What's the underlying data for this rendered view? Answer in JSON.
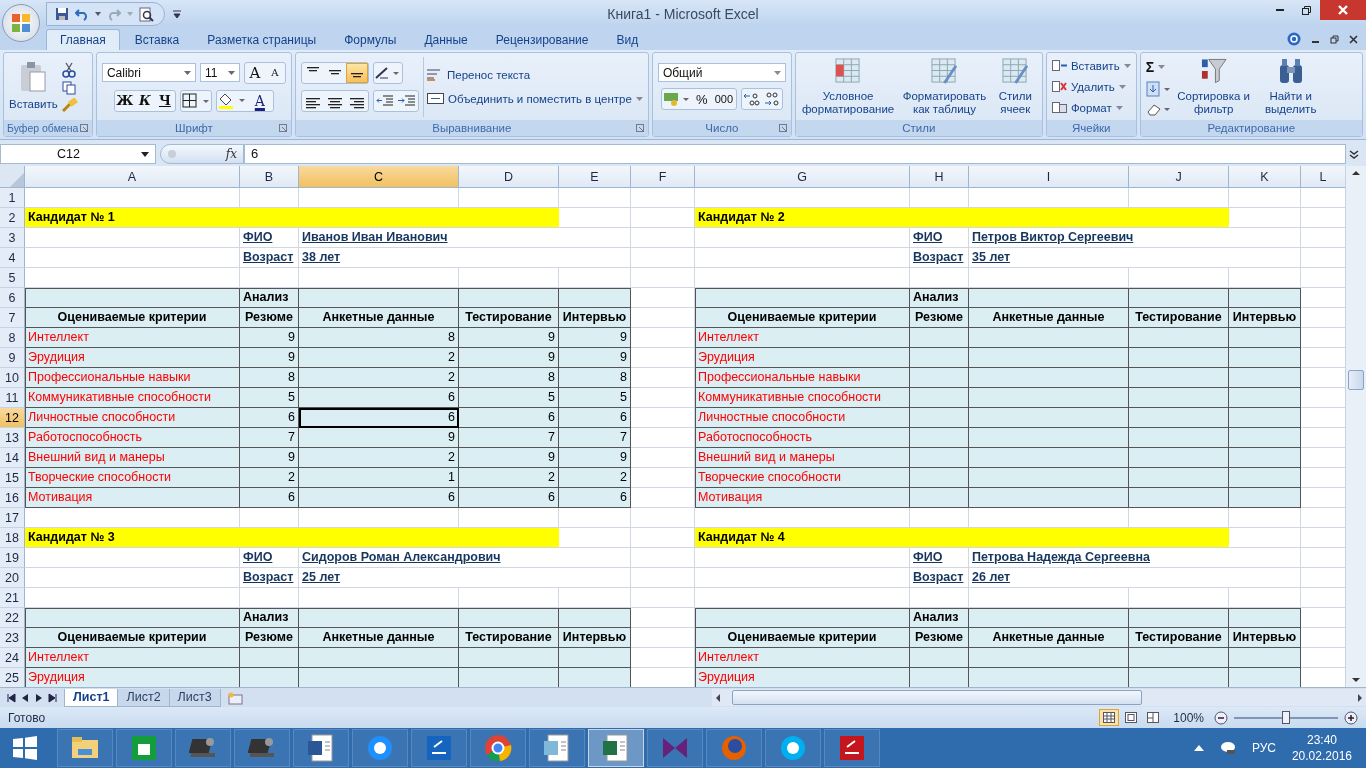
{
  "window": {
    "title": "Книга1 - Microsoft Excel"
  },
  "tabs": [
    {
      "label": "Главная",
      "selected": true
    },
    {
      "label": "Вставка",
      "selected": false
    },
    {
      "label": "Разметка страницы",
      "selected": false
    },
    {
      "label": "Формулы",
      "selected": false
    },
    {
      "label": "Данные",
      "selected": false
    },
    {
      "label": "Рецензирование",
      "selected": false
    },
    {
      "label": "Вид",
      "selected": false
    }
  ],
  "ribbon": {
    "clipboard": {
      "label": "Буфер обмена",
      "paste": "Вставить"
    },
    "font": {
      "label": "Шрифт",
      "font": "Calibri",
      "size": "11",
      "grow": "A",
      "shrink": "A",
      "bold": "Ж",
      "italic": "К",
      "underline": "Ч",
      "font_color": "A"
    },
    "alignment": {
      "label": "Выравнивание",
      "vertical": [
        {
          "selected": false
        },
        {
          "selected": false
        },
        {
          "selected": true
        }
      ],
      "wrap": "Перенос текста",
      "merge": "Объединить и поместить в центре"
    },
    "number": {
      "label": "Число",
      "format": "Общий",
      "percent": "%",
      "thousands": "000"
    },
    "styles": {
      "label": "Стили",
      "buttons": [
        "Условное форматирование",
        "Форматировать как таблицу",
        "Стили ячеек"
      ]
    },
    "cells": {
      "label": "Ячейки",
      "buttons": [
        "Вставить",
        "Удалить",
        "Формат"
      ]
    },
    "editing": {
      "label": "Редактирование",
      "sum": "Σ",
      "buttons": [
        "Сортировка и фильтр",
        "Найти и выделить"
      ]
    }
  },
  "formula_bar": {
    "name_box": "C12",
    "fx": "fx",
    "value": "6"
  },
  "sheet": {
    "columns": [
      {
        "label": "A",
        "selected": false
      },
      {
        "label": "B",
        "selected": false
      },
      {
        "label": "C",
        "selected": true
      },
      {
        "label": "D",
        "selected": false
      },
      {
        "label": "E",
        "selected": false
      },
      {
        "label": "F",
        "selected": false
      },
      {
        "label": "G",
        "selected": false
      },
      {
        "label": "H",
        "selected": false
      },
      {
        "label": "I",
        "selected": false
      },
      {
        "label": "J",
        "selected": false
      },
      {
        "label": "K",
        "selected": false
      },
      {
        "label": "L",
        "selected": false
      }
    ],
    "rows": [
      {
        "label": "1",
        "selected": false
      },
      {
        "label": "2",
        "selected": false
      },
      {
        "label": "3",
        "selected": false
      },
      {
        "label": "4",
        "selected": false
      },
      {
        "label": "5",
        "selected": false
      },
      {
        "label": "6",
        "selected": false
      },
      {
        "label": "7",
        "selected": false
      },
      {
        "label": "8",
        "selected": false
      },
      {
        "label": "9",
        "selected": false
      },
      {
        "label": "10",
        "selected": false
      },
      {
        "label": "11",
        "selected": false
      },
      {
        "label": "12",
        "selected": true
      },
      {
        "label": "13",
        "selected": false
      },
      {
        "label": "14",
        "selected": false
      },
      {
        "label": "15",
        "selected": false
      },
      {
        "label": "16",
        "selected": false
      },
      {
        "label": "17",
        "selected": false
      },
      {
        "label": "18",
        "selected": false
      },
      {
        "label": "19",
        "selected": false
      },
      {
        "label": "20",
        "selected": false
      },
      {
        "label": "21",
        "selected": false
      },
      {
        "label": "22",
        "selected": false
      },
      {
        "label": "23",
        "selected": false
      },
      {
        "label": "24",
        "selected": false
      },
      {
        "label": "25",
        "selected": false
      }
    ]
  },
  "candidates": [
    {
      "title": "Кандидат № 1",
      "fields": [
        {
          "label": "ФИО",
          "value": "Иванов Иван Иванович"
        },
        {
          "label": "Возраст",
          "value": "38 лет"
        }
      ],
      "group_heading": "Анализ",
      "columns": [
        "Оцениваемые критерии",
        "Резюме",
        "Анкетные данные",
        "Тестирование",
        "Интервью"
      ],
      "rows": [
        {
          "criterion": "Интеллект",
          "values": [
            {
              "text": "9",
              "selected": false
            },
            {
              "text": "8",
              "selected": false
            },
            {
              "text": "9",
              "selected": false
            },
            {
              "text": "9",
              "selected": false
            }
          ]
        },
        {
          "criterion": "Эрудиция",
          "values": [
            {
              "text": "9",
              "selected": false
            },
            {
              "text": "2",
              "selected": false
            },
            {
              "text": "9",
              "selected": false
            },
            {
              "text": "9",
              "selected": false
            }
          ]
        },
        {
          "criterion": "Профессиональные навыки",
          "values": [
            {
              "text": "8",
              "selected": false
            },
            {
              "text": "2",
              "selected": false
            },
            {
              "text": "8",
              "selected": false
            },
            {
              "text": "8",
              "selected": false
            }
          ]
        },
        {
          "criterion": "Коммуникативные способности",
          "values": [
            {
              "text": "5",
              "selected": false
            },
            {
              "text": "6",
              "selected": false
            },
            {
              "text": "5",
              "selected": false
            },
            {
              "text": "5",
              "selected": false
            }
          ]
        },
        {
          "criterion": "Личностные способности",
          "values": [
            {
              "text": "6",
              "selected": false
            },
            {
              "text": "6",
              "selected": true
            },
            {
              "text": "6",
              "selected": false
            },
            {
              "text": "6",
              "selected": false
            }
          ]
        },
        {
          "criterion": "Работоспособность",
          "values": [
            {
              "text": "7",
              "selected": false
            },
            {
              "text": "9",
              "selected": false
            },
            {
              "text": "7",
              "selected": false
            },
            {
              "text": "7",
              "selected": false
            }
          ]
        },
        {
          "criterion": "Внешний вид и манеры",
          "values": [
            {
              "text": "9",
              "selected": false
            },
            {
              "text": "2",
              "selected": false
            },
            {
              "text": "9",
              "selected": false
            },
            {
              "text": "9",
              "selected": false
            }
          ]
        },
        {
          "criterion": "Творческие способности",
          "values": [
            {
              "text": "2",
              "selected": false
            },
            {
              "text": "1",
              "selected": false
            },
            {
              "text": "2",
              "selected": false
            },
            {
              "text": "2",
              "selected": false
            }
          ]
        },
        {
          "criterion": "Мотивация",
          "values": [
            {
              "text": "6",
              "selected": false
            },
            {
              "text": "6",
              "selected": false
            },
            {
              "text": "6",
              "selected": false
            },
            {
              "text": "6",
              "selected": false
            }
          ]
        }
      ]
    },
    {
      "title": "Кандидат № 2",
      "fields": [
        {
          "label": "ФИО",
          "value": "Петров Виктор Сергеевич"
        },
        {
          "label": "Возраст",
          "value": "35 лет"
        }
      ],
      "group_heading": "Анализ",
      "columns": [
        "Оцениваемые критерии",
        "Резюме",
        "Анкетные данные",
        "Тестирование",
        "Интервью"
      ],
      "rows": [
        {
          "criterion": "Интеллект"
        },
        {
          "criterion": "Эрудиция"
        },
        {
          "criterion": "Профессиональные навыки"
        },
        {
          "criterion": "Коммуникативные способности"
        },
        {
          "criterion": "Личностные способности"
        },
        {
          "criterion": "Работоспособность"
        },
        {
          "criterion": "Внешний вид и манеры"
        },
        {
          "criterion": "Творческие способности"
        },
        {
          "criterion": "Мотивация"
        }
      ]
    },
    {
      "title": "Кандидат № 3",
      "fields": [
        {
          "label": "ФИО",
          "value": "Сидоров Роман Александрович"
        },
        {
          "label": "Возраст",
          "value": "25 лет"
        }
      ],
      "group_heading": "Анализ",
      "columns": [
        "Оцениваемые критерии",
        "Резюме",
        "Анкетные данные",
        "Тестирование",
        "Интервью"
      ],
      "rows": [
        {
          "criterion": "Интеллект"
        },
        {
          "criterion": "Эрудиция"
        }
      ]
    },
    {
      "title": "Кандидат № 4",
      "fields": [
        {
          "label": "ФИО",
          "value": "Петрова Надежда Сергеевна"
        },
        {
          "label": "Возраст",
          "value": "26 лет"
        }
      ],
      "group_heading": "Анализ",
      "columns": [
        "Оцениваемые критерии",
        "Резюме",
        "Анкетные данные",
        "Тестирование",
        "Интервью"
      ],
      "rows": [
        {
          "criterion": "Интеллект"
        },
        {
          "criterion": "Эрудиция"
        }
      ]
    }
  ],
  "sheet_tabs": [
    {
      "label": "Лист1",
      "selected": true
    },
    {
      "label": "Лист2",
      "selected": false
    },
    {
      "label": "Лист3",
      "selected": false
    }
  ],
  "status_bar": {
    "status": "Готово",
    "views": [
      {
        "selected": true
      },
      {
        "selected": false
      },
      {
        "selected": false
      }
    ],
    "zoom": "100%",
    "zoom_slider": {
      "level": 0.5
    }
  },
  "taskbar": {
    "language": "РУС",
    "time": "23:40",
    "date": "20.02.2016"
  }
}
